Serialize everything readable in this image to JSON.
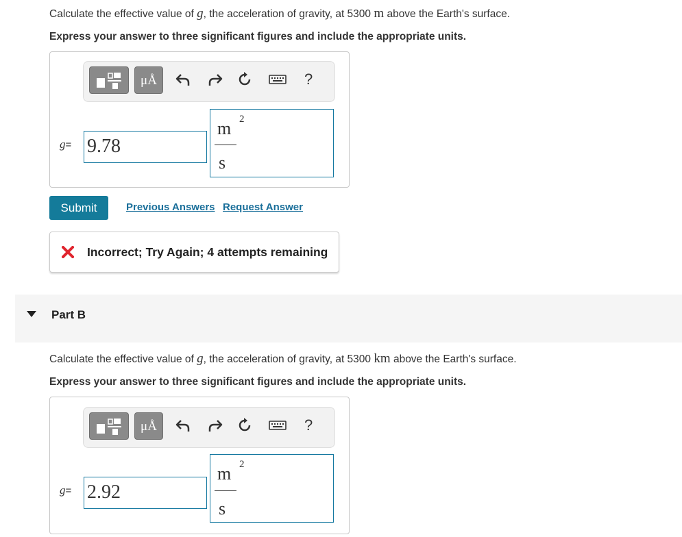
{
  "part_a": {
    "question": {
      "prefix": "Calculate the effective value of ",
      "var": "g",
      "middle": ", the acceleration of gravity, at 5300 ",
      "unit": "m",
      "suffix": " above the Earth's surface."
    },
    "instruction": "Express your answer to three significant figures and include the appropriate units.",
    "toolbar": {
      "units_button_label": "μÅ",
      "help_label": "?"
    },
    "variable": "g",
    "equals": "=",
    "value": "9.78",
    "units": {
      "numerator": "m",
      "exponent": "2",
      "denominator": "s"
    },
    "submit_label": "Submit",
    "previous_answers_label": "Previous Answers",
    "request_answer_label": "Request Answer",
    "feedback": {
      "icon": "x-icon",
      "color": "#e0252e",
      "text": "Incorrect; Try Again; 4 attempts remaining"
    }
  },
  "part_b": {
    "title": "Part B",
    "question": {
      "prefix": "Calculate the effective value of ",
      "var": "g",
      "middle": ", the acceleration of gravity, at 5300 ",
      "unit": "km",
      "suffix": " above the Earth's surface."
    },
    "instruction": "Express your answer to three significant figures and include the appropriate units.",
    "toolbar": {
      "units_button_label": "μÅ",
      "help_label": "?"
    },
    "variable": "g",
    "equals": "=",
    "value": "2.92",
    "units": {
      "numerator": "m",
      "exponent": "2",
      "denominator": "s"
    }
  },
  "colors": {
    "accent": "#147b9a",
    "link": "#1a6f9a",
    "error": "#e0252e",
    "input_border": "#1478a0"
  }
}
